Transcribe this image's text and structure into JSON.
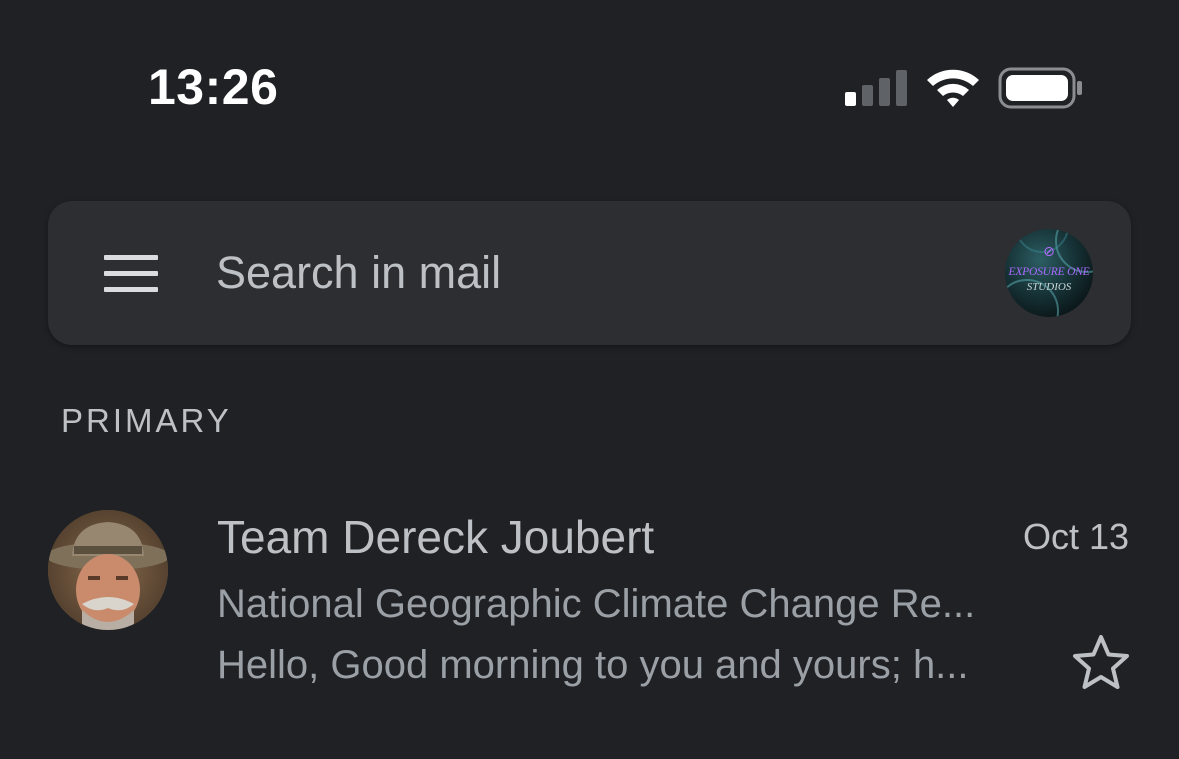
{
  "status_bar": {
    "time": "13:26",
    "signal_icon": "cellular-signal-icon",
    "wifi_icon": "wifi-icon",
    "battery_icon": "battery-icon"
  },
  "search": {
    "menu_icon": "hamburger-menu-icon",
    "placeholder": "Search in mail",
    "value": "",
    "account_avatar": {
      "line1": "EXPOSURE ONE",
      "line2": "STUDIOS"
    }
  },
  "section": {
    "label": "PRIMARY"
  },
  "emails": [
    {
      "sender": "Team Dereck Joubert",
      "date": "Oct 13",
      "subject": "National Geographic Climate Change Re...",
      "snippet": "Hello, Good morning to you and yours; h...",
      "starred": false,
      "star_icon": "star-outline-icon"
    }
  ],
  "colors": {
    "background": "#202124",
    "search_bar": "#2d2e31",
    "primary_text": "#bdc1c6",
    "secondary_text": "#9aa0a6"
  }
}
